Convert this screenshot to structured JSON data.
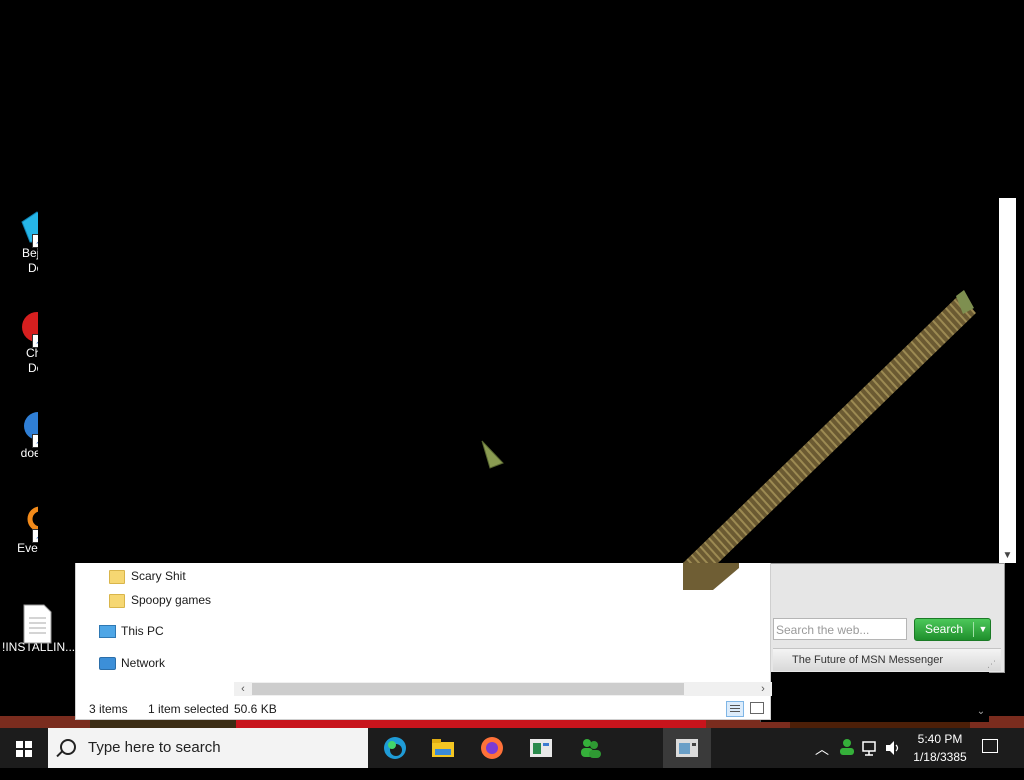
{
  "desktop": {
    "icons": [
      {
        "label": "Bejev\nDel",
        "icon": "gem-icon"
      },
      {
        "label": "Chu\nDel",
        "icon": "red-ball-icon"
      },
      {
        "label": "doesn",
        "icon": "bird-icon"
      },
      {
        "label": "Every...",
        "icon": "search-ring-icon"
      },
      {
        "label": "!INSTALLIN...",
        "icon": "text-file-icon"
      }
    ]
  },
  "explorer": {
    "nav": {
      "folder1": "Scary Shit",
      "folder2": "Spoopy games",
      "this_pc": "This PC",
      "network": "Network"
    },
    "status": {
      "count": "3 items",
      "selected": "1 item selected",
      "size": "50.6 KB"
    }
  },
  "msn": {
    "search_placeholder": "Search the web...",
    "search_button": "Search",
    "footer_link": "The Future of MSN Messenger"
  },
  "taskbar": {
    "search_placeholder": "Type here to search",
    "apps": [
      "edge-icon",
      "file-explorer-icon",
      "firefox-icon",
      "app-window-icon",
      "messenger-people-icon",
      "active-window-icon"
    ],
    "clock_time": "5:40 PM",
    "clock_date": "1/18/3385"
  },
  "colors": {
    "taskbar_bg": "#1c1c1c",
    "msn_search_green": "#2aa23a",
    "folder_yellow": "#f6d772"
  }
}
